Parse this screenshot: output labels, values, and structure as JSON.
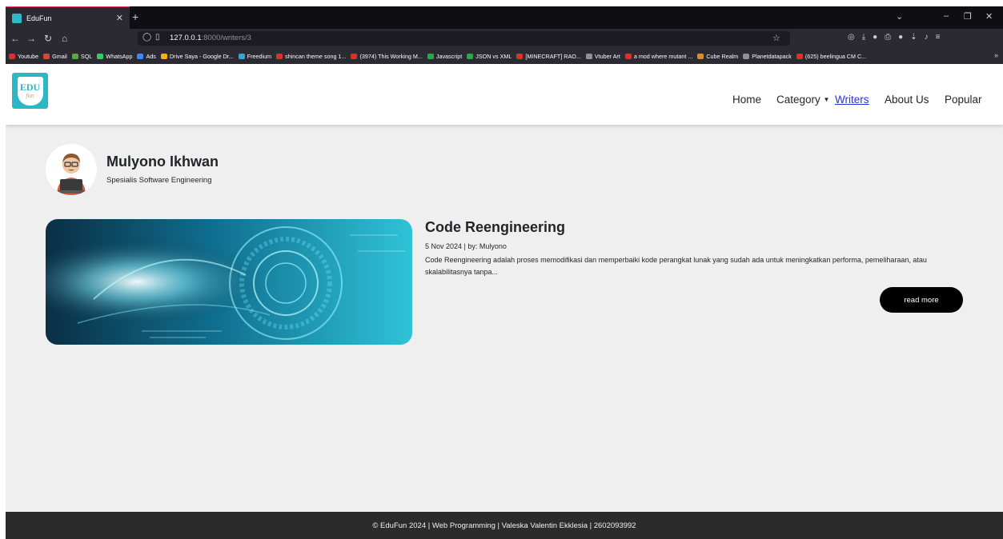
{
  "browser": {
    "tab_title": "EduFun",
    "url_host": "127.0.0.1",
    "url_rest": ":8000/writers/3",
    "bookmarks": [
      {
        "label": "Youtube",
        "color": "#e02d2d"
      },
      {
        "label": "Gmail",
        "color": "#d9453a"
      },
      {
        "label": "SQL",
        "color": "#59a83a"
      },
      {
        "label": "WhatsApp",
        "color": "#25d366"
      },
      {
        "label": "Ads",
        "color": "#4285f4"
      },
      {
        "label": "Drive Saya - Google Dr...",
        "color": "#f4b400"
      },
      {
        "label": "Freedium",
        "color": "#3aa0d8"
      },
      {
        "label": "shincan theme song 1...",
        "color": "#e02d2d"
      },
      {
        "label": "(3974) This Working M...",
        "color": "#e02d2d"
      },
      {
        "label": "Javascript",
        "color": "#2da44e"
      },
      {
        "label": "JSON vs XML",
        "color": "#2da44e"
      },
      {
        "label": "[MINECRAFT] RAO...",
        "color": "#e02d2d"
      },
      {
        "label": "Vtuber Art",
        "color": "#8f8f9d"
      },
      {
        "label": "a mod where mutant ...",
        "color": "#e02d2d"
      },
      {
        "label": "Cube Realm",
        "color": "#d6902b"
      },
      {
        "label": "Planetdatapack",
        "color": "#8f8f9d"
      },
      {
        "label": "(625) beelingua CM C...",
        "color": "#e02d2d"
      }
    ]
  },
  "site": {
    "logo_top": "EDU",
    "logo_bottom": "fun",
    "nav": {
      "home": "Home",
      "category": "Category",
      "writers": "Writers",
      "about": "About Us",
      "popular": "Popular"
    }
  },
  "writer": {
    "name": "Mulyono Ikhwan",
    "specialty": "Spesialis Software Engineering"
  },
  "post": {
    "title": "Code Reengineering",
    "meta": "5 Nov 2024 | by: Mulyono",
    "excerpt": "Code Reengineering adalah proses memodifikasi dan memperbaiki kode perangkat lunak yang sudah ada untuk meningkatkan performa, pemeliharaan, atau skalabilitasnya tanpa...",
    "read_more": "read more"
  },
  "footer": {
    "text": "© EduFun 2024 | Web Programming | Valeska Valentin Ekklesia | 2602093992"
  },
  "colors": {
    "brand": "#2bb8c6",
    "active_link": "#2a31d8",
    "footer_bg": "#2b2b2b"
  }
}
